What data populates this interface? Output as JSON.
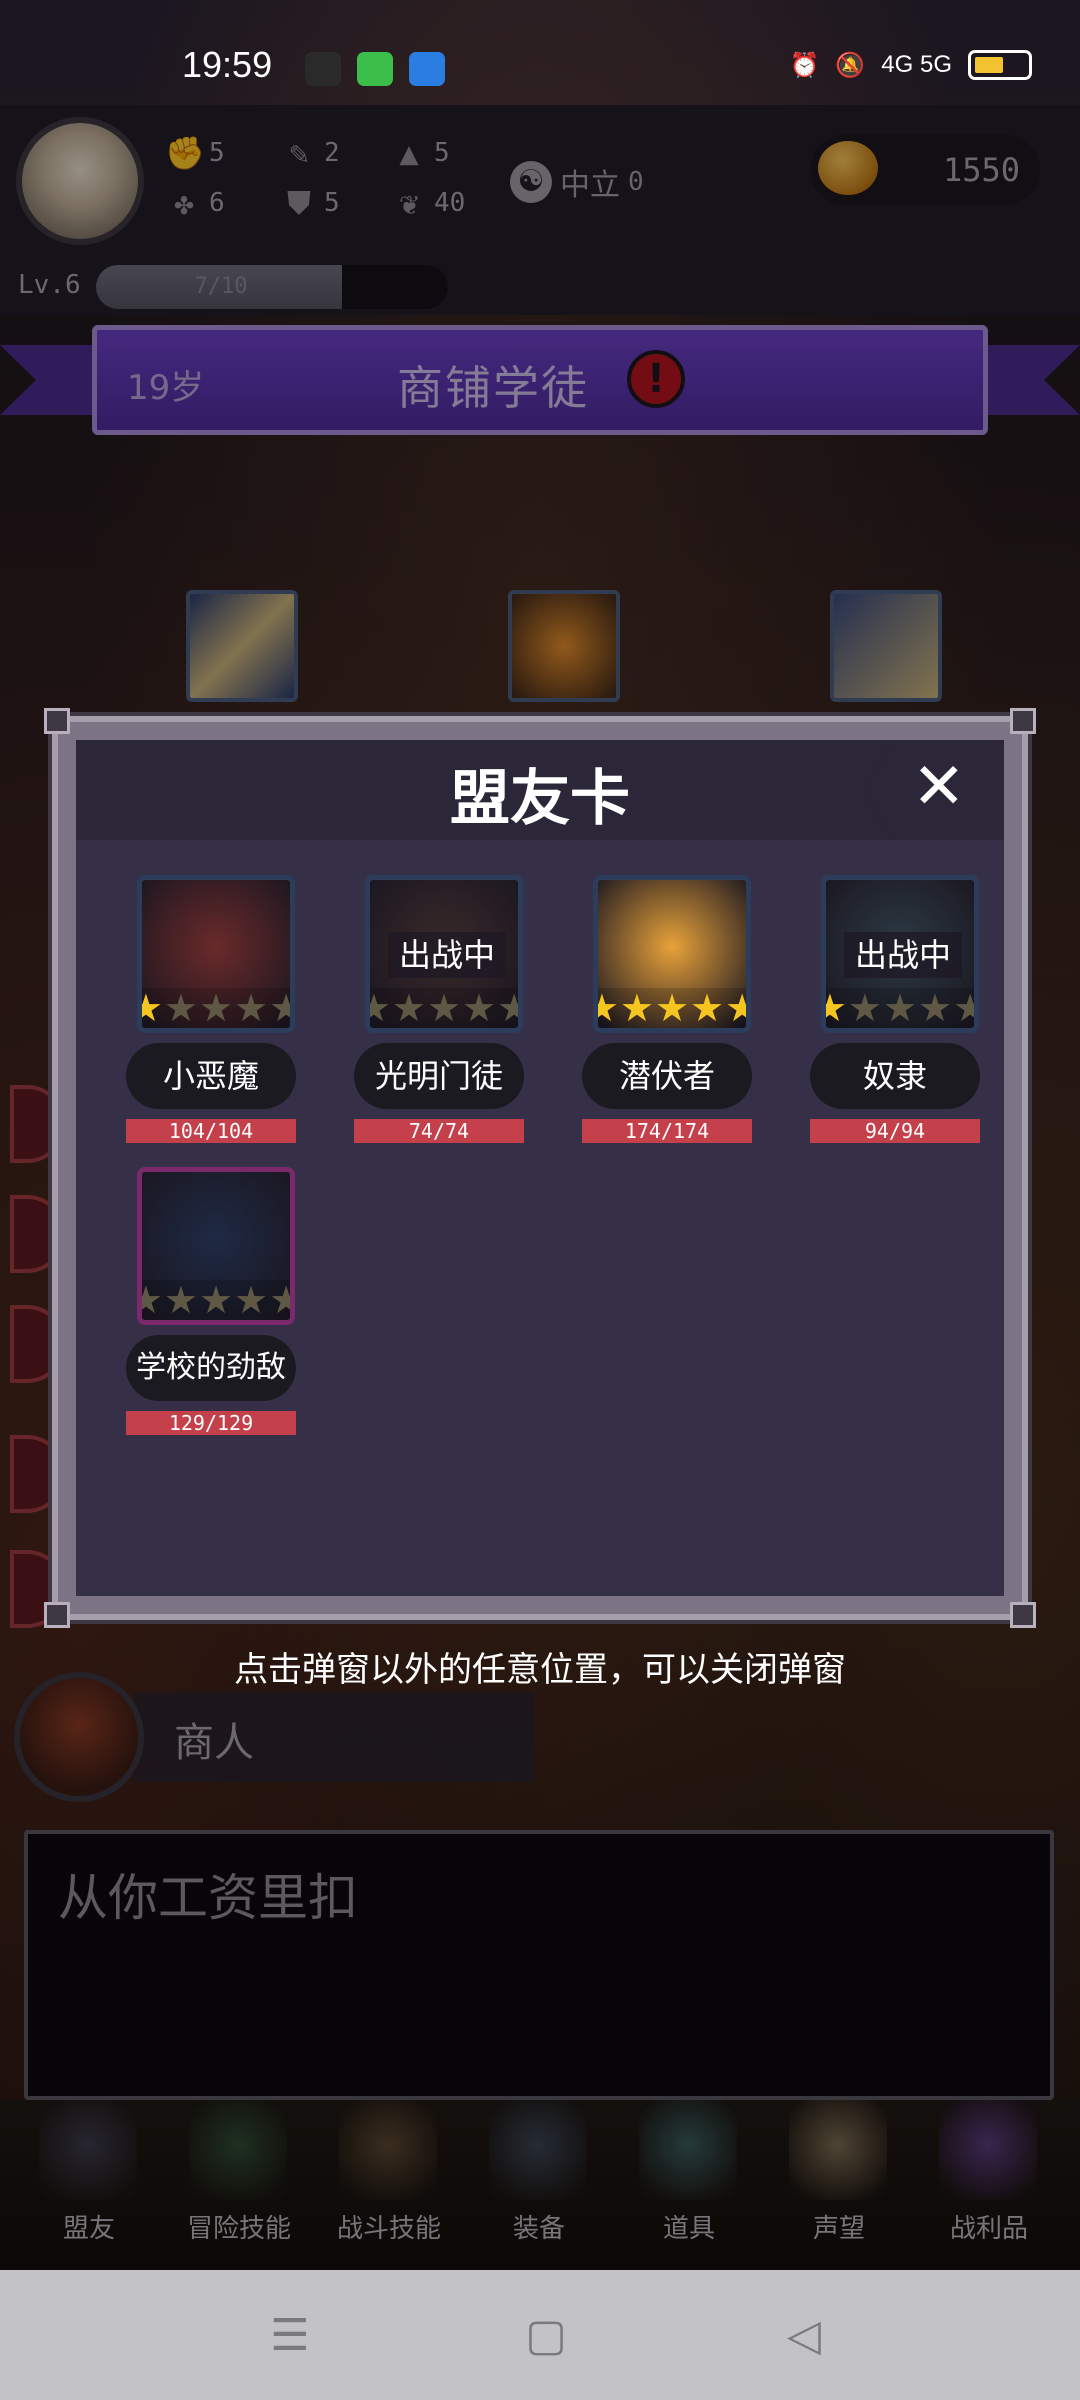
{
  "status_bar": {
    "time": "19:59",
    "network": "4G 5G"
  },
  "hud": {
    "stats": [
      {
        "icon": "fist-icon",
        "value": "5"
      },
      {
        "icon": "clover-icon",
        "value": "6"
      },
      {
        "icon": "quill-icon",
        "value": "2"
      },
      {
        "icon": "shield-icon",
        "value": "5"
      },
      {
        "icon": "wizard-hat-icon",
        "value": "5"
      },
      {
        "icon": "lotus-icon",
        "value": "40"
      }
    ],
    "alignment": {
      "label": "中立",
      "value": "0"
    },
    "gold": "1550",
    "level": "Lv.6",
    "xp_text": "7/10",
    "xp_fraction": 0.7
  },
  "banner": {
    "age": "19岁",
    "title": "商铺学徒",
    "alert": "!"
  },
  "modal": {
    "title": "盟友卡",
    "close": "✕",
    "cards": [
      {
        "name": "小恶魔",
        "hp": "104/104",
        "stars": 1,
        "deployed": false,
        "frame": "#2b3d5a",
        "bg": "#6a2a2a"
      },
      {
        "name": "光明门徒",
        "hp": "74/74",
        "stars": 0,
        "deployed": true,
        "deploy_label": "出战中",
        "frame": "#2b3d5a",
        "bg": "#3a2a2a"
      },
      {
        "name": "潜伏者",
        "hp": "174/174",
        "stars": 5,
        "deployed": false,
        "frame": "#2b3d5a",
        "bg": "#e8a23a"
      },
      {
        "name": "奴隶",
        "hp": "94/94",
        "stars": 1,
        "deployed": true,
        "deploy_label": "出战中",
        "frame": "#2b3d5a",
        "bg": "#2c3a44"
      },
      {
        "name": "学校的劲敌",
        "hp": "129/129",
        "stars": 0,
        "deployed": false,
        "frame": "#7a2a6a",
        "bg": "#1e2a44"
      }
    ]
  },
  "hint": "点击弹窗以外的任意位置，可以关闭弹窗",
  "npc": {
    "name": "商人"
  },
  "dialog": {
    "text": "从你工资里扣"
  },
  "menu": [
    {
      "label": "盟友",
      "icon": "handshake-icon",
      "color": "#3d3a4a"
    },
    {
      "label": "冒险技能",
      "icon": "book-icon",
      "color": "#2f4a34"
    },
    {
      "label": "战斗技能",
      "icon": "backpack-icon",
      "color": "#5a4630"
    },
    {
      "label": "装备",
      "icon": "swords-icon",
      "color": "#3a4452"
    },
    {
      "label": "道具",
      "icon": "satchel-icon",
      "color": "#3a5a5a"
    },
    {
      "label": "声望",
      "icon": "scroll-icon",
      "color": "#7a6a50"
    },
    {
      "label": "战利品",
      "icon": "treasure-chest-icon",
      "color": "#5a3a7a"
    }
  ]
}
